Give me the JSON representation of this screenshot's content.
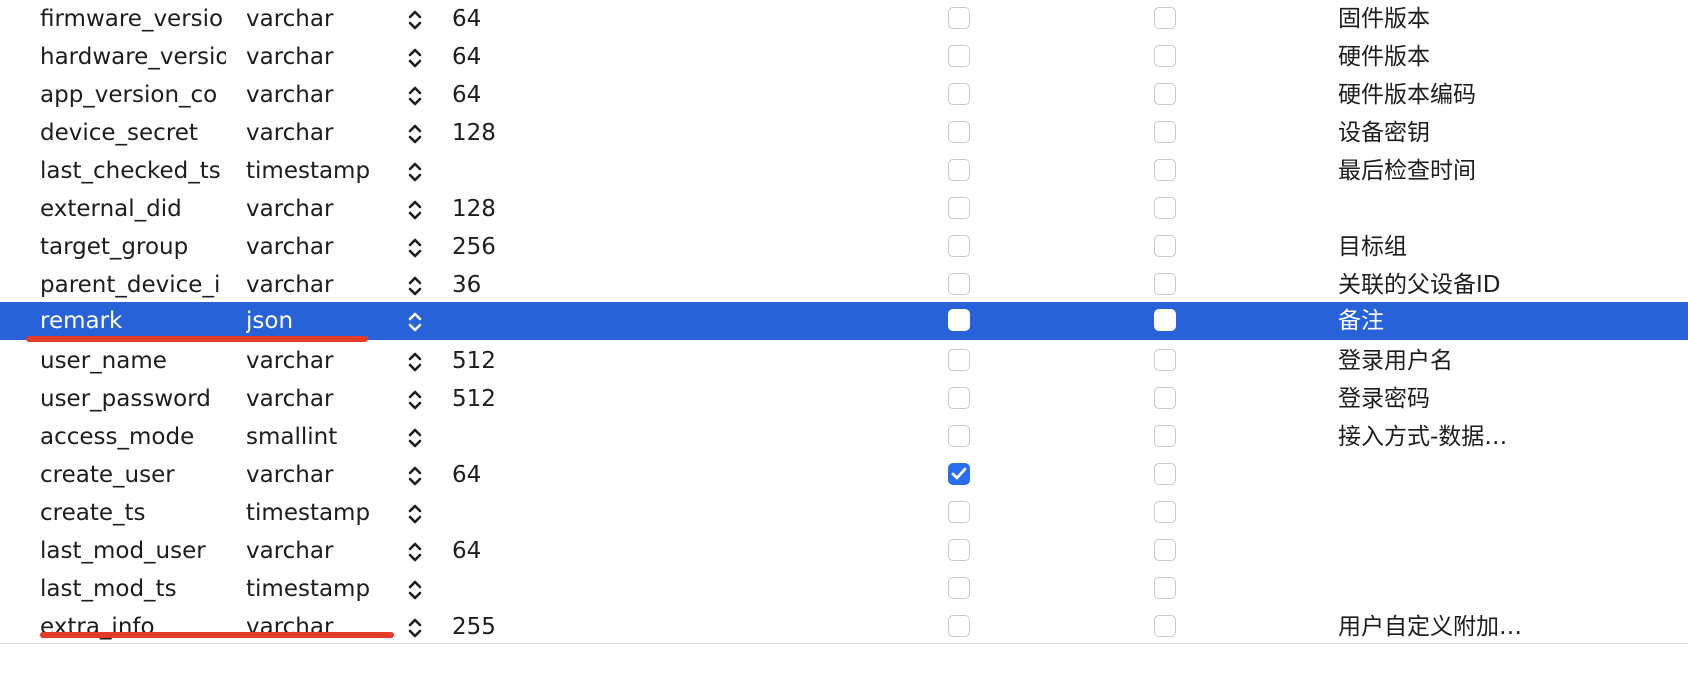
{
  "columns_table": {
    "selected_row": 8,
    "rows": [
      {
        "name": "firmware_versio",
        "type": "varchar",
        "length": "64",
        "flag1": false,
        "flag2": false,
        "comment": "固件版本"
      },
      {
        "name": "hardware_versio",
        "type": "varchar",
        "length": "64",
        "flag1": false,
        "flag2": false,
        "comment": "硬件版本"
      },
      {
        "name": "app_version_co",
        "type": "varchar",
        "length": "64",
        "flag1": false,
        "flag2": false,
        "comment": "硬件版本编码"
      },
      {
        "name": "device_secret",
        "type": "varchar",
        "length": "128",
        "flag1": false,
        "flag2": false,
        "comment": "设备密钥"
      },
      {
        "name": "last_checked_ts",
        "type": "timestamp",
        "length": "",
        "flag1": false,
        "flag2": false,
        "comment": "最后检查时间"
      },
      {
        "name": "external_did",
        "type": "varchar",
        "length": "128",
        "flag1": false,
        "flag2": false,
        "comment": ""
      },
      {
        "name": "target_group",
        "type": "varchar",
        "length": "256",
        "flag1": false,
        "flag2": false,
        "comment": "目标组"
      },
      {
        "name": "parent_device_i",
        "type": "varchar",
        "length": "36",
        "flag1": false,
        "flag2": false,
        "comment": "关联的父设备ID"
      },
      {
        "name": "remark",
        "type": "json",
        "length": "",
        "flag1": false,
        "flag2": false,
        "comment": "备注"
      },
      {
        "name": "user_name",
        "type": "varchar",
        "length": "512",
        "flag1": false,
        "flag2": false,
        "comment": "登录用户名"
      },
      {
        "name": "user_password",
        "type": "varchar",
        "length": "512",
        "flag1": false,
        "flag2": false,
        "comment": "登录密码"
      },
      {
        "name": "access_mode",
        "type": "smallint",
        "length": "",
        "flag1": false,
        "flag2": false,
        "comment": "接入方式-数据…"
      },
      {
        "name": "create_user",
        "type": "varchar",
        "length": "64",
        "flag1": true,
        "flag2": false,
        "comment": ""
      },
      {
        "name": "create_ts",
        "type": "timestamp",
        "length": "",
        "flag1": false,
        "flag2": false,
        "comment": ""
      },
      {
        "name": "last_mod_user",
        "type": "varchar",
        "length": "64",
        "flag1": false,
        "flag2": false,
        "comment": ""
      },
      {
        "name": "last_mod_ts",
        "type": "timestamp",
        "length": "",
        "flag1": false,
        "flag2": false,
        "comment": ""
      },
      {
        "name": "extra_info",
        "type": "varchar",
        "length": "255",
        "flag1": false,
        "flag2": false,
        "comment": "用户自定义附加…"
      }
    ]
  },
  "colors": {
    "selection": "#2762d9",
    "checkbox_checked": "#2a6ef0",
    "annotation_underline": "#e23b2a"
  },
  "icons": {
    "type_stepper": "chevron-up-down-icon",
    "checkmark": "checkmark-icon"
  }
}
